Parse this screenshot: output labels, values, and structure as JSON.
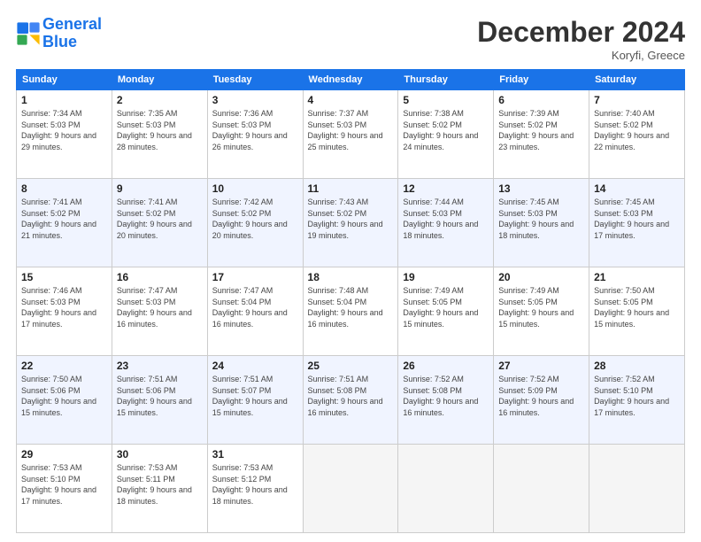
{
  "header": {
    "logo_line1": "General",
    "logo_line2": "Blue",
    "title": "December 2024",
    "location": "Koryfi, Greece"
  },
  "days_of_week": [
    "Sunday",
    "Monday",
    "Tuesday",
    "Wednesday",
    "Thursday",
    "Friday",
    "Saturday"
  ],
  "weeks": [
    [
      {
        "day": "1",
        "sunrise": "7:34 AM",
        "sunset": "5:03 PM",
        "daylight": "9 hours and 29 minutes."
      },
      {
        "day": "2",
        "sunrise": "7:35 AM",
        "sunset": "5:03 PM",
        "daylight": "9 hours and 28 minutes."
      },
      {
        "day": "3",
        "sunrise": "7:36 AM",
        "sunset": "5:03 PM",
        "daylight": "9 hours and 26 minutes."
      },
      {
        "day": "4",
        "sunrise": "7:37 AM",
        "sunset": "5:03 PM",
        "daylight": "9 hours and 25 minutes."
      },
      {
        "day": "5",
        "sunrise": "7:38 AM",
        "sunset": "5:02 PM",
        "daylight": "9 hours and 24 minutes."
      },
      {
        "day": "6",
        "sunrise": "7:39 AM",
        "sunset": "5:02 PM",
        "daylight": "9 hours and 23 minutes."
      },
      {
        "day": "7",
        "sunrise": "7:40 AM",
        "sunset": "5:02 PM",
        "daylight": "9 hours and 22 minutes."
      }
    ],
    [
      {
        "day": "8",
        "sunrise": "7:41 AM",
        "sunset": "5:02 PM",
        "daylight": "9 hours and 21 minutes."
      },
      {
        "day": "9",
        "sunrise": "7:41 AM",
        "sunset": "5:02 PM",
        "daylight": "9 hours and 20 minutes."
      },
      {
        "day": "10",
        "sunrise": "7:42 AM",
        "sunset": "5:02 PM",
        "daylight": "9 hours and 20 minutes."
      },
      {
        "day": "11",
        "sunrise": "7:43 AM",
        "sunset": "5:02 PM",
        "daylight": "9 hours and 19 minutes."
      },
      {
        "day": "12",
        "sunrise": "7:44 AM",
        "sunset": "5:03 PM",
        "daylight": "9 hours and 18 minutes."
      },
      {
        "day": "13",
        "sunrise": "7:45 AM",
        "sunset": "5:03 PM",
        "daylight": "9 hours and 18 minutes."
      },
      {
        "day": "14",
        "sunrise": "7:45 AM",
        "sunset": "5:03 PM",
        "daylight": "9 hours and 17 minutes."
      }
    ],
    [
      {
        "day": "15",
        "sunrise": "7:46 AM",
        "sunset": "5:03 PM",
        "daylight": "9 hours and 17 minutes."
      },
      {
        "day": "16",
        "sunrise": "7:47 AM",
        "sunset": "5:03 PM",
        "daylight": "9 hours and 16 minutes."
      },
      {
        "day": "17",
        "sunrise": "7:47 AM",
        "sunset": "5:04 PM",
        "daylight": "9 hours and 16 minutes."
      },
      {
        "day": "18",
        "sunrise": "7:48 AM",
        "sunset": "5:04 PM",
        "daylight": "9 hours and 16 minutes."
      },
      {
        "day": "19",
        "sunrise": "7:49 AM",
        "sunset": "5:05 PM",
        "daylight": "9 hours and 15 minutes."
      },
      {
        "day": "20",
        "sunrise": "7:49 AM",
        "sunset": "5:05 PM",
        "daylight": "9 hours and 15 minutes."
      },
      {
        "day": "21",
        "sunrise": "7:50 AM",
        "sunset": "5:05 PM",
        "daylight": "9 hours and 15 minutes."
      }
    ],
    [
      {
        "day": "22",
        "sunrise": "7:50 AM",
        "sunset": "5:06 PM",
        "daylight": "9 hours and 15 minutes."
      },
      {
        "day": "23",
        "sunrise": "7:51 AM",
        "sunset": "5:06 PM",
        "daylight": "9 hours and 15 minutes."
      },
      {
        "day": "24",
        "sunrise": "7:51 AM",
        "sunset": "5:07 PM",
        "daylight": "9 hours and 15 minutes."
      },
      {
        "day": "25",
        "sunrise": "7:51 AM",
        "sunset": "5:08 PM",
        "daylight": "9 hours and 16 minutes."
      },
      {
        "day": "26",
        "sunrise": "7:52 AM",
        "sunset": "5:08 PM",
        "daylight": "9 hours and 16 minutes."
      },
      {
        "day": "27",
        "sunrise": "7:52 AM",
        "sunset": "5:09 PM",
        "daylight": "9 hours and 16 minutes."
      },
      {
        "day": "28",
        "sunrise": "7:52 AM",
        "sunset": "5:10 PM",
        "daylight": "9 hours and 17 minutes."
      }
    ],
    [
      {
        "day": "29",
        "sunrise": "7:53 AM",
        "sunset": "5:10 PM",
        "daylight": "9 hours and 17 minutes."
      },
      {
        "day": "30",
        "sunrise": "7:53 AM",
        "sunset": "5:11 PM",
        "daylight": "9 hours and 18 minutes."
      },
      {
        "day": "31",
        "sunrise": "7:53 AM",
        "sunset": "5:12 PM",
        "daylight": "9 hours and 18 minutes."
      },
      null,
      null,
      null,
      null
    ]
  ]
}
